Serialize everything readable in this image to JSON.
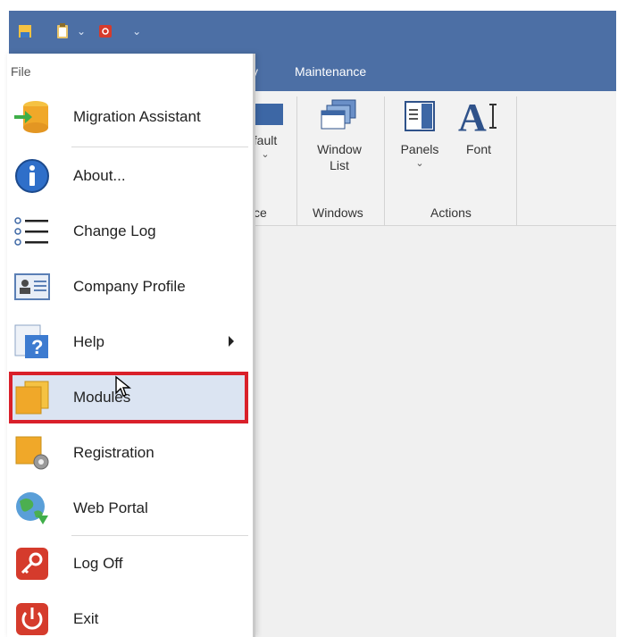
{
  "ribbon": {
    "tabs": [
      {
        "label": "y"
      },
      {
        "label": "Maintenance"
      }
    ],
    "buttons": {
      "default_label": "fault",
      "window_list_label": "Window\nList",
      "panels_label": "Panels",
      "font_label": "Font"
    },
    "groups": {
      "partial_label": "ce",
      "windows_label": "Windows",
      "actions_label": "Actions"
    }
  },
  "menu": {
    "title": "File",
    "items": [
      {
        "label": "Migration Assistant",
        "icon": "migration-assistant-icon"
      },
      {
        "label": "About...",
        "icon": "info-icon"
      },
      {
        "label": "Change Log",
        "icon": "list-icon"
      },
      {
        "label": "Company Profile",
        "icon": "id-card-icon"
      },
      {
        "label": "Help",
        "icon": "help-icon"
      },
      {
        "label": "Modules",
        "icon": "folder-stack-icon"
      },
      {
        "label": "Registration",
        "icon": "registration-icon"
      },
      {
        "label": "Web Portal",
        "icon": "globe-icon"
      },
      {
        "label": "Log Off",
        "icon": "key-icon"
      },
      {
        "label": "Exit",
        "icon": "power-icon"
      }
    ]
  },
  "colors": {
    "titlebar": "#4c6fa5",
    "highlight_border": "#d9202a",
    "highlight_fill": "#dbe4f2"
  }
}
